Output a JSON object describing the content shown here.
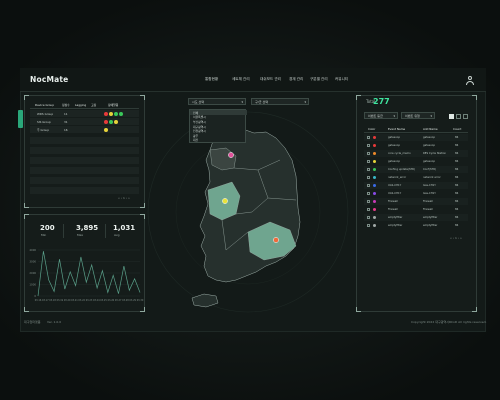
{
  "app": {
    "logo": "NocMate"
  },
  "nav": {
    "items": [
      "통합현황",
      "세트체 관리",
      "대쉬보드 관리",
      "경계 관리",
      "구분별 관리",
      "커뮤니티"
    ]
  },
  "device_panel": {
    "headers": [
      "Device Group",
      "정상수",
      "Lagging",
      "고장",
      "장애알림"
    ],
    "rows": [
      {
        "group": "WDS Group",
        "count": "11"
      },
      {
        "group": "SIS Group",
        "count": "31"
      },
      {
        "group": "주 Group",
        "count": "16"
      }
    ],
    "alert_dots": [
      [
        "#e63a3a",
        "#e6d23a",
        "#3ac85a",
        "#3ac85a"
      ],
      [
        "#e63a3a",
        "#3ac85a",
        "#e6d23a"
      ],
      [
        "#e6d23a"
      ]
    ],
    "pager": "« ‹ 1 › »"
  },
  "stats_panel": {
    "stats": [
      {
        "value": "200",
        "label": "Min"
      },
      {
        "value": "3,895",
        "label": "Max"
      },
      {
        "value": "1,031",
        "label": "Avg"
      }
    ]
  },
  "chart_data": {
    "type": "line",
    "x": [
      "03.16",
      "03.17",
      "03.18",
      "03.19",
      "03.20",
      "03.21",
      "03.22",
      "03.23",
      "03.24",
      "03.25",
      "03.26",
      "03.27",
      "03.28",
      "03.29",
      "03.30"
    ],
    "series": [
      {
        "values": [
          0,
          3895,
          1400,
          400,
          3200,
          600,
          2100,
          900,
          3400,
          1200,
          2700,
          700,
          2200,
          300,
          1800,
          200,
          2600,
          500,
          1500,
          300
        ]
      }
    ],
    "y_ticks": [
      "4000",
      "3000",
      "2000",
      "1000",
      "0"
    ],
    "ylim": [
      0,
      4000
    ],
    "grid": true,
    "color": "#5aa08a"
  },
  "map": {
    "select1": {
      "value": "시도 선택"
    },
    "select2": {
      "value": "구/군 선택"
    },
    "select1_options": [
      "전체",
      "서울특별시",
      "부산광역시",
      "대구광역시",
      "인천광역시",
      "광주",
      "대전"
    ],
    "markers": [
      {
        "color": "#e0529a"
      },
      {
        "color": "#e8e23a"
      },
      {
        "color": "#ee6a3a"
      }
    ]
  },
  "event_panel": {
    "total_label": "Total",
    "total_value": "277",
    "filter1": "이벤트 등급",
    "filter2": "이벤트 유형",
    "headers": [
      "Color",
      "Event Name",
      "Add Name",
      "Count"
    ],
    "rows": [
      {
        "color": "#e63a3a",
        "name": "gatesoop",
        "add": "gatesoop",
        "count": "86"
      },
      {
        "color": "#e63a3a",
        "name": "gatesoop",
        "add": "gatesoop",
        "count": "86"
      },
      {
        "color": "#ee8a2a",
        "name": "core cycle_memo",
        "add": "RES Cycle Station",
        "count": "86"
      },
      {
        "color": "#e6d23a",
        "name": "gatesoop",
        "add": "gatesoop",
        "count": "86"
      },
      {
        "color": "#3ac85a",
        "name": "Confing update(STR)",
        "add": "Conf(STR)",
        "count": "86"
      },
      {
        "color": "#3ab8c8",
        "name": "network_error",
        "add": "network error",
        "count": "86"
      },
      {
        "color": "#3a6ae6",
        "name": "UAS-CH1Y",
        "add": "Gas-CH1Y",
        "count": "86"
      },
      {
        "color": "#8a4ae6",
        "name": "UAS-CH1Y",
        "add": "Gas-CH1Y",
        "count": "86"
      },
      {
        "color": "#c83ab8",
        "name": "Firewall",
        "add": "Firewall",
        "count": "86"
      },
      {
        "color": "#e63a8a",
        "name": "Firewall",
        "add": "Firewall",
        "count": "86"
      },
      {
        "color": "#a0a8a6",
        "name": "emptyfilter",
        "add": "emptyfilter",
        "count": "86"
      },
      {
        "color": "#a0a8a6",
        "name": "emptyfilter",
        "add": "emptyfilter",
        "count": "86"
      }
    ],
    "pager": "« ‹ 1 › »"
  },
  "footer": {
    "left1": "대구업파랫폼",
    "left2": "Ver. 1.0.0",
    "right": "Copyright 2022 대구광역시RCoD All rights reserved."
  }
}
